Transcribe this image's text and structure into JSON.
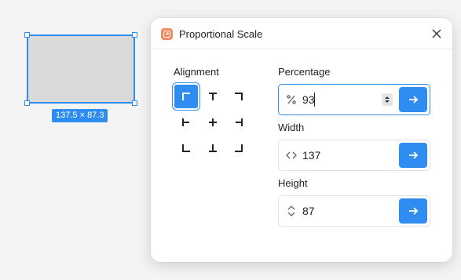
{
  "canvas": {
    "size_label": "137.5 × 87.3"
  },
  "dialog": {
    "title": "Proportional Scale",
    "icons": {
      "app": "scale-app-icon",
      "close": "close-icon"
    }
  },
  "alignment": {
    "label": "Alignment",
    "selected": "top-left",
    "options": [
      "top-left",
      "top-center",
      "top-right",
      "middle-left",
      "center",
      "middle-right",
      "bottom-left",
      "bottom-center",
      "bottom-right"
    ]
  },
  "percentage": {
    "label": "Percentage",
    "value": "93",
    "icon": "percent-icon"
  },
  "width": {
    "label": "Width",
    "value": "137",
    "icon": "horizontal-arrows-icon"
  },
  "height": {
    "label": "Height",
    "value": "87",
    "icon": "vertical-arrows-icon"
  },
  "colors": {
    "accent": "#2f8cf0",
    "app_icon": "#f2895c"
  }
}
